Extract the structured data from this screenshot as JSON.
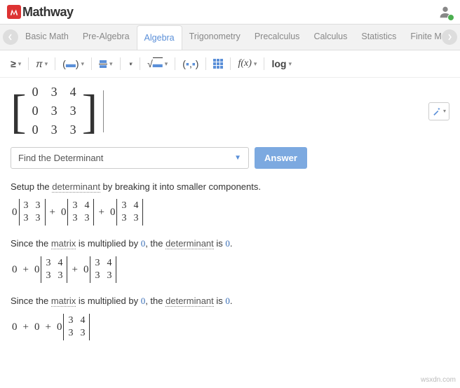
{
  "header": {
    "brand_text": "Mathway"
  },
  "tabs": {
    "items": [
      {
        "label": "Basic Math",
        "active": false
      },
      {
        "label": "Pre-Algebra",
        "active": false
      },
      {
        "label": "Algebra",
        "active": true
      },
      {
        "label": "Trigonometry",
        "active": false
      },
      {
        "label": "Precalculus",
        "active": false
      },
      {
        "label": "Calculus",
        "active": false
      },
      {
        "label": "Statistics",
        "active": false
      },
      {
        "label": "Finite Math",
        "active": false
      }
    ]
  },
  "toolbar": {
    "ge": "≥",
    "pi": "π",
    "sqrt": "√",
    "fx": "f(x)",
    "log": "log"
  },
  "problem": {
    "matrix": [
      [
        "0",
        "3",
        "4"
      ],
      [
        "0",
        "3",
        "3"
      ],
      [
        "0",
        "3",
        "3"
      ]
    ]
  },
  "action": {
    "select_label": "Find the Determinant",
    "answer_label": "Answer"
  },
  "steps": [
    {
      "text_parts": [
        "Setup the ",
        "determinant",
        " by breaking it into smaller components."
      ],
      "expr": {
        "type": "cofactor3",
        "terms": [
          {
            "coef": "0",
            "m": [
              [
                "3",
                "3"
              ],
              [
                "3",
                "3"
              ]
            ]
          },
          {
            "coef": "0",
            "m": [
              [
                "3",
                "4"
              ],
              [
                "3",
                "3"
              ]
            ]
          },
          {
            "coef": "0",
            "m": [
              [
                "3",
                "4"
              ],
              [
                "3",
                "3"
              ]
            ]
          }
        ]
      }
    },
    {
      "text_parts": [
        "Since the ",
        "matrix",
        " is multiplied by ",
        "0",
        ", the ",
        "determinant",
        " is ",
        "0",
        "."
      ],
      "expr": {
        "type": "reduce2",
        "prefix": [
          "0"
        ],
        "terms": [
          {
            "coef": "0",
            "m": [
              [
                "3",
                "4"
              ],
              [
                "3",
                "3"
              ]
            ]
          },
          {
            "coef": "0",
            "m": [
              [
                "3",
                "4"
              ],
              [
                "3",
                "3"
              ]
            ]
          }
        ]
      }
    },
    {
      "text_parts": [
        "Since the ",
        "matrix",
        " is multiplied by ",
        "0",
        ", the ",
        "determinant",
        " is ",
        "0",
        "."
      ],
      "expr": {
        "type": "reduce1",
        "prefix": [
          "0",
          "0"
        ],
        "terms": [
          {
            "coef": "0",
            "m": [
              [
                "3",
                "4"
              ],
              [
                "3",
                "3"
              ]
            ]
          }
        ]
      }
    }
  ],
  "watermark": "wsxdn.com"
}
